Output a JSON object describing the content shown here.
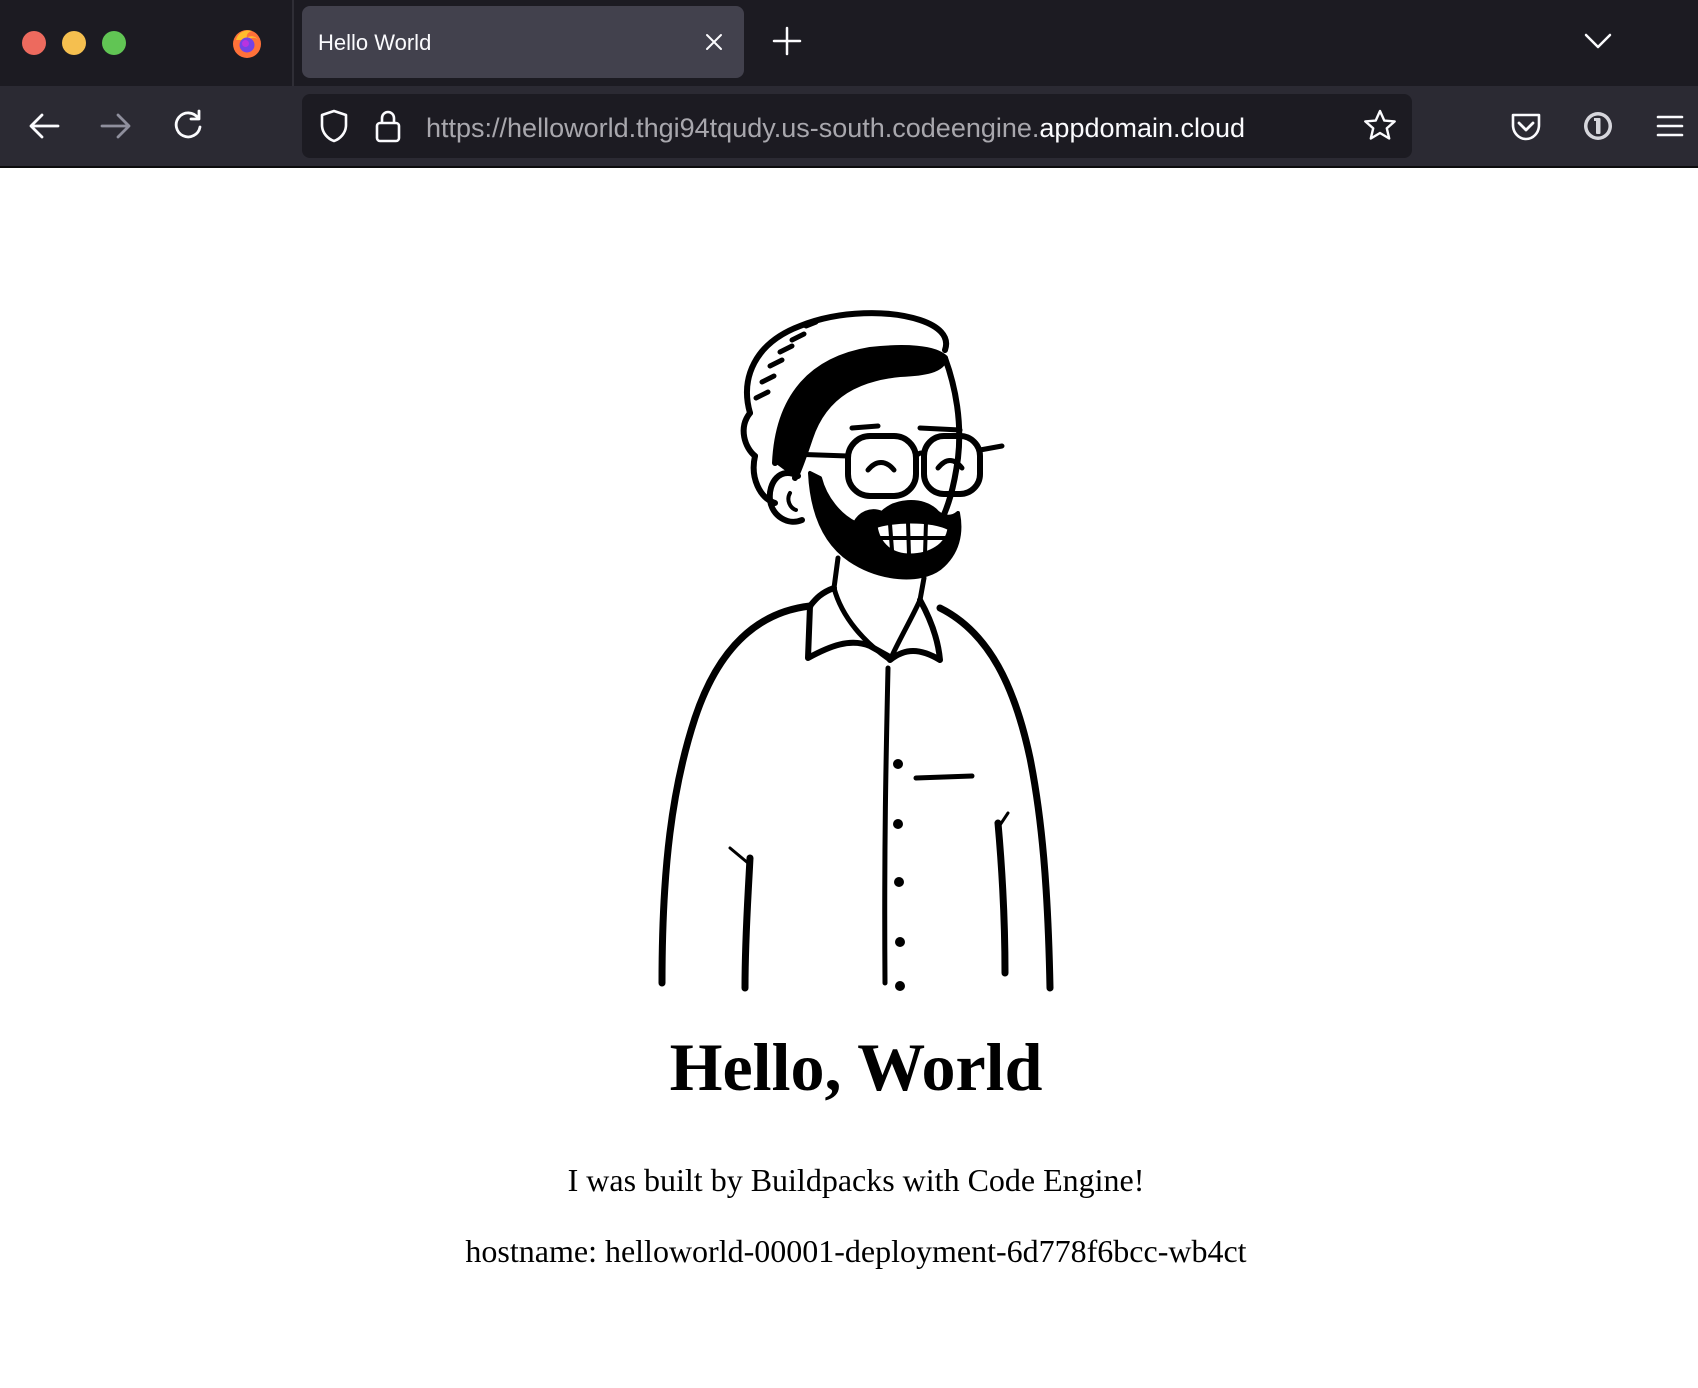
{
  "browser": {
    "tab": {
      "title": "Hello World"
    },
    "url": {
      "prefix": "https://helloworld.thgi94tqudy.us-south.codeengine.",
      "domain": "appdomain.cloud"
    },
    "icons": {
      "window_controls": [
        "close-dot",
        "minimize-dot",
        "maximize-dot"
      ],
      "tab_strip": [
        "firefox-logo-icon",
        "close-icon",
        "plus-icon",
        "chevron-down-icon"
      ],
      "toolbar": [
        "back-arrow-icon",
        "forward-arrow-icon",
        "reload-icon",
        "shield-icon",
        "lock-icon",
        "star-icon",
        "pocket-icon",
        "password-manager-icon",
        "hamburger-menu-icon"
      ]
    }
  },
  "page": {
    "heading": "Hello, World",
    "message": "I was built by Buildpacks with Code Engine!",
    "hostname": "hostname: helloworld-00001-deployment-6d778f6bcc-wb4ct"
  }
}
